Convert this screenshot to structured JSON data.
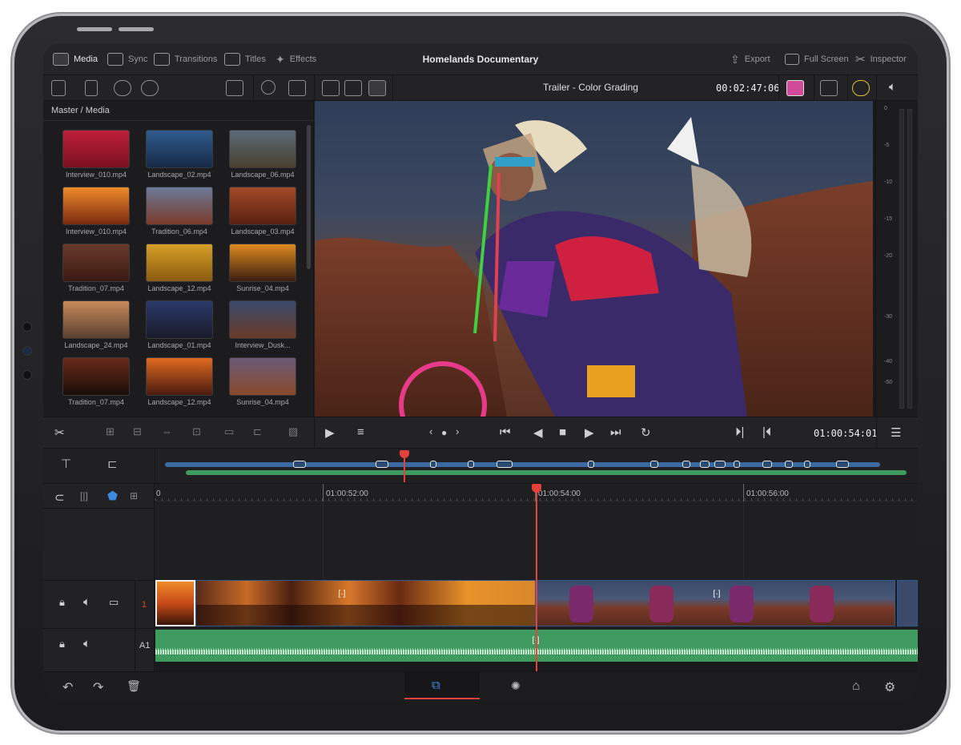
{
  "header": {
    "app_title": "Homelands Documentary",
    "tabs": [
      {
        "label": "Media",
        "icon": "media-icon"
      },
      {
        "label": "Sync",
        "icon": "sync-icon"
      },
      {
        "label": "Transitions",
        "icon": "transitions-icon"
      },
      {
        "label": "Titles",
        "icon": "titles-icon"
      },
      {
        "label": "Effects",
        "icon": "effects-icon"
      }
    ],
    "right_tabs": [
      {
        "label": "Export",
        "icon": "export-icon"
      },
      {
        "label": "Full Screen",
        "icon": "fullscreen-icon"
      },
      {
        "label": "Inspector",
        "icon": "inspector-icon"
      }
    ]
  },
  "viewer": {
    "clip_name": "Trailer - Color Grading",
    "clip_timecode": "00:02:47:06",
    "playback_timecode": "01:00:54:01"
  },
  "media_pool": {
    "breadcrumb": "Master / Media",
    "clips": [
      {
        "name": "Interview_010.mp4",
        "colors": [
          "#c0203a",
          "#7a1020"
        ]
      },
      {
        "name": "Landscape_02.mp4",
        "colors": [
          "#2f5c8f",
          "#162a45"
        ]
      },
      {
        "name": "Landscape_06.mp4",
        "colors": [
          "#5b6a78",
          "#4a4030"
        ]
      },
      {
        "name": "Interview_010.mp4",
        "colors": [
          "#f08a2a",
          "#7a2a10"
        ]
      },
      {
        "name": "Tradition_06.mp4",
        "colors": [
          "#6a7a98",
          "#7a3a2a"
        ]
      },
      {
        "name": "Landscape_03.mp4",
        "colors": [
          "#a34a28",
          "#5a2010"
        ]
      },
      {
        "name": "Tradition_07.mp4",
        "colors": [
          "#6a3a2a",
          "#3a1a14"
        ]
      },
      {
        "name": "Landscape_12.mp4",
        "colors": [
          "#d8a028",
          "#8a5a10"
        ]
      },
      {
        "name": "Sunrise_04.mp4",
        "colors": [
          "#e08a20",
          "#3a1e10"
        ]
      },
      {
        "name": "Landscape_24.mp4",
        "colors": [
          "#c88a5a",
          "#5a4030"
        ]
      },
      {
        "name": "Landscape_01.mp4",
        "colors": [
          "#2a3a6a",
          "#1a1a2a"
        ]
      },
      {
        "name": "Interview_Dusk...",
        "colors": [
          "#3a4a6a",
          "#6a3a2a"
        ]
      },
      {
        "name": "Tradition_07.mp4",
        "colors": [
          "#6a2a1a",
          "#1a0e0a"
        ]
      },
      {
        "name": "Landscape_12.mp4",
        "colors": [
          "#e06a20",
          "#4a1a10"
        ]
      },
      {
        "name": "Sunrise_04.mp4",
        "colors": [
          "#6a5a78",
          "#8a4a2a"
        ]
      }
    ]
  },
  "meter": {
    "labels": [
      "0",
      "-5",
      "-10",
      "-15",
      "-20",
      "-30",
      "-40",
      "-50"
    ]
  },
  "timeline": {
    "ruler_labels": [
      "0",
      "01:00:52:00",
      "01:00:54:00",
      "01:00:56:00"
    ],
    "video_track_number": "1",
    "audio_track_label": "A1"
  },
  "colors": {
    "accent_red": "#e5403a",
    "video_clip_blue": "#3b6aa0",
    "audio_clip_green": "#3e9a5e"
  }
}
